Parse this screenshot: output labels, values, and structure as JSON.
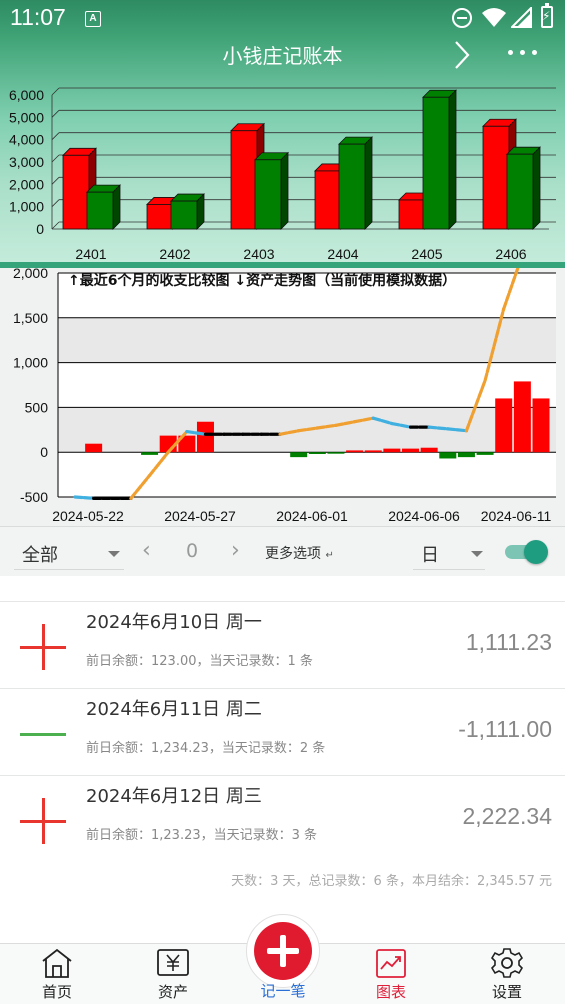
{
  "status_bar": {
    "time": "11:07",
    "a_icon_letter": "A",
    "icons": [
      "a-icon",
      "dnd-icon",
      "wifi-icon",
      "signal-icon",
      "battery-icon"
    ]
  },
  "header": {
    "title": "小钱庄记账本",
    "icons": [
      "chevron-right-icon",
      "more-icon"
    ]
  },
  "chart_data": [
    {
      "type": "bar",
      "categories": [
        "2401",
        "2402",
        "2403",
        "2404",
        "2405",
        "2406"
      ],
      "series": [
        {
          "color": "#ff0000",
          "values": [
            3300,
            1100,
            4400,
            2600,
            1300,
            4600
          ]
        },
        {
          "color": "#008000",
          "values": [
            1650,
            1250,
            3100,
            3800,
            5900,
            3350
          ]
        }
      ],
      "ytick_labels": [
        "0",
        "1,000",
        "2,000",
        "3,000",
        "4,000",
        "5,000",
        "6,000"
      ],
      "ylim": [
        0,
        6000
      ],
      "grid": true,
      "style": "3d"
    },
    {
      "type": "bar",
      "title": "↑最近6个月的收支比较图 ↓资产走势图（当前使用模拟数据）",
      "ytick_labels": [
        "-500",
        "0",
        "500",
        "1,000",
        "1,500",
        "2,000"
      ],
      "ylim": [
        -500,
        2000
      ],
      "xtick_labels": [
        "2024-05-22",
        "2024-05-27",
        "2024-06-01",
        "2024-06-06",
        "2024-06-11"
      ],
      "bars": {
        "days": [
          1,
          4,
          5,
          6,
          7,
          12,
          13,
          14,
          15,
          16,
          17,
          18,
          19,
          20,
          21,
          22
        ],
        "values": [
          95,
          -30,
          185,
          185,
          340,
          -55,
          -20,
          -15,
          20,
          20,
          40,
          40,
          50,
          -70,
          -55,
          -30
        ],
        "positive_color": "#ff0000",
        "negative_color": "#008000"
      },
      "late_bars": {
        "days": [
          23,
          24,
          25
        ],
        "values": [
          600,
          790,
          600
        ]
      },
      "asset_line": {
        "x": [
          0,
          1,
          2,
          3,
          4,
          5,
          6,
          7,
          8,
          9,
          10,
          11,
          12,
          13,
          14,
          15,
          16,
          17,
          18,
          19,
          20,
          21,
          22,
          23,
          24,
          25
        ],
        "y": [
          -500,
          -515,
          -515,
          -515,
          -260,
          0,
          230,
          200,
          200,
          200,
          200,
          200,
          240,
          270,
          300,
          340,
          380,
          320,
          280,
          280,
          260,
          240,
          800,
          1600,
          2200,
          2240
        ]
      },
      "line_colors": {
        "up": "#f0a030",
        "down": "#40b0e0",
        "flat": "#000000"
      },
      "grid": true
    }
  ],
  "filter": {
    "category": "全部",
    "prev_icon": "‹",
    "page": "0",
    "next_icon": "›",
    "more_options": "更多选项",
    "more_options_mark": "↵",
    "period": "日",
    "toggle_on": true
  },
  "records": [
    {
      "type": "income",
      "date": "2024年6月10日 周一",
      "info": "前日余额：123.00，当天记录数：1 条",
      "amount": "1,111.23"
    },
    {
      "type": "expense",
      "date": "2024年6月11日 周二",
      "info": "前日余额：1,234.23，当天记录数：2 条",
      "amount": "-1,111.00"
    },
    {
      "type": "income",
      "date": "2024年6月12日 周三",
      "info": "前日余额：1,23.23，当天记录数：3 条",
      "amount": "2,222.34"
    }
  ],
  "summary": "天数：3 天，总记录数：6 条，本月结余：2,345.57 元",
  "nav": [
    {
      "label": "首页",
      "icon": "home-icon",
      "active": false
    },
    {
      "label": "资产",
      "icon": "yen-icon",
      "active": false
    },
    {
      "label": "图表",
      "icon": "chart-icon",
      "active": true
    },
    {
      "label": "设置",
      "icon": "gear-icon",
      "active": false
    }
  ],
  "fab": {
    "label": "记一笔",
    "icon": "plus-icon"
  },
  "colors": {
    "income": "#e8362f",
    "expense": "#4caf50",
    "active_nav": "#e0203a",
    "accent": "#1f9d80"
  }
}
